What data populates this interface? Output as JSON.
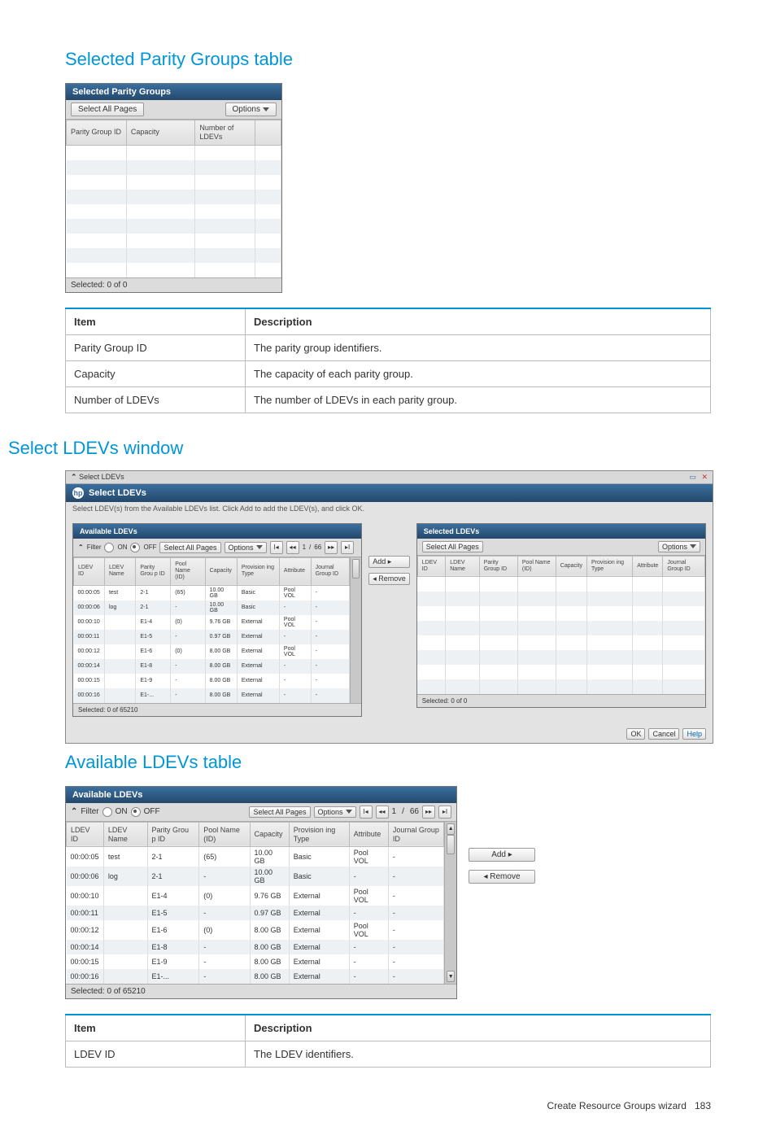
{
  "section1": {
    "heading": "Selected Parity Groups table",
    "panel_title": "Selected Parity Groups",
    "select_all": "Select All Pages",
    "options": "Options",
    "columns": [
      "Parity\nGroup ID",
      "Capacity",
      "Number\nof LDEVs",
      ""
    ],
    "selected_text": "Selected: 0   of  0",
    "def_table": {
      "head": [
        "Item",
        "Description"
      ],
      "rows": [
        [
          "Parity Group ID",
          "The parity group identifiers."
        ],
        [
          "Capacity",
          "The capacity of each parity group."
        ],
        [
          "Number of LDEVs",
          "The number of LDEVs in each parity group."
        ]
      ]
    }
  },
  "section2": {
    "heading": "Select LDEVs window",
    "dlg_title_bar": "Select LDEVs",
    "dlg_title": "Select LDEVs",
    "dlg_instr": "Select LDEV(s) from the Available LDEVs list. Click Add to add the LDEV(s), and click OK.",
    "available": {
      "title": "Available LDEVs",
      "filter": "Filter",
      "on": "ON",
      "off": "OFF",
      "select_all": "Select All Pages",
      "options": "Options",
      "page_current": "1",
      "page_sep": "/",
      "page_total": "66",
      "columns": [
        "LDEV ID",
        "LDEV\nName",
        "Parity\nGrou\np ID",
        "Pool\nName\n(ID)",
        "Capacity",
        "Provision\ning Type",
        "Attribute",
        "Journal\nGroup ID"
      ],
      "rows": [
        [
          "00:00:05",
          "test",
          "2-1",
          "(65)",
          "10.00 GB",
          "Basic",
          "Pool VOL",
          "-"
        ],
        [
          "00:00:06",
          "log",
          "2-1",
          "-",
          "10.00 GB",
          "Basic",
          "-",
          "-"
        ],
        [
          "00:00:10",
          "",
          "E1-4",
          "(0)",
          "9.76 GB",
          "External",
          "Pool VOL",
          "-"
        ],
        [
          "00:00:11",
          "",
          "E1-5",
          "-",
          "0.97 GB",
          "External",
          "-",
          "-"
        ],
        [
          "00:00:12",
          "",
          "E1-6",
          "(0)",
          "8.00 GB",
          "External",
          "Pool VOL",
          "-"
        ],
        [
          "00:00:14",
          "",
          "E1-8",
          "-",
          "8.00 GB",
          "External",
          "-",
          "-"
        ],
        [
          "00:00:15",
          "",
          "E1-9",
          "-",
          "8.00 GB",
          "External",
          "-",
          "-"
        ],
        [
          "00:00:16",
          "",
          "E1-...",
          "-",
          "8.00 GB",
          "External",
          "-",
          "-"
        ]
      ],
      "selected_text": "Selected: 0   of  65210"
    },
    "add_btn": "Add ▸",
    "remove_btn": "◂ Remove",
    "selected": {
      "title": "Selected LDEVs",
      "select_all": "Select All Pages",
      "options": "Options",
      "columns": [
        "LDEV ID",
        "LDEV\nName",
        "Parity\nGroup\nID",
        "Pool\nName\n(ID)",
        "Capacity",
        "Provision\ning Type",
        "Attribute",
        "Journal\nGroup\nID"
      ],
      "selected_text": "Selected: 0   of  0"
    },
    "ok": "OK",
    "cancel": "Cancel",
    "help": "Help"
  },
  "section3": {
    "heading": "Available LDEVs table",
    "panel": {
      "title": "Available LDEVs",
      "filter": "Filter",
      "on": "ON",
      "off": "OFF",
      "select_all": "Select All Pages",
      "options": "Options",
      "page_current": "1",
      "page_sep": "/",
      "page_total": "66",
      "columns": [
        "LDEV ID",
        "LDEV\nName",
        "Parity\nGrou\np ID",
        "Pool\nName\n(ID)",
        "Capacity",
        "Provision\ning Type",
        "Attribute",
        "Journal\nGroup ID"
      ],
      "rows": [
        [
          "00:00:05",
          "test",
          "2-1",
          "(65)",
          "10.00 GB",
          "Basic",
          "Pool VOL",
          "-"
        ],
        [
          "00:00:06",
          "log",
          "2-1",
          "-",
          "10.00 GB",
          "Basic",
          "-",
          "-"
        ],
        [
          "00:00:10",
          "",
          "E1-4",
          "(0)",
          "9.76 GB",
          "External",
          "Pool VOL",
          "-"
        ],
        [
          "00:00:11",
          "",
          "E1-5",
          "-",
          "0.97 GB",
          "External",
          "-",
          "-"
        ],
        [
          "00:00:12",
          "",
          "E1-6",
          "(0)",
          "8.00 GB",
          "External",
          "Pool VOL",
          "-"
        ],
        [
          "00:00:14",
          "",
          "E1-8",
          "-",
          "8.00 GB",
          "External",
          "-",
          "-"
        ],
        [
          "00:00:15",
          "",
          "E1-9",
          "-",
          "8.00 GB",
          "External",
          "-",
          "-"
        ],
        [
          "00:00:16",
          "",
          "E1-...",
          "-",
          "8.00 GB",
          "External",
          "-",
          "-"
        ]
      ],
      "selected_text": "Selected: 0   of  65210"
    },
    "add_btn": "Add ▸",
    "remove_btn": "◂ Remove",
    "def_table": {
      "head": [
        "Item",
        "Description"
      ],
      "rows": [
        [
          "LDEV ID",
          "The LDEV identifiers."
        ]
      ]
    }
  },
  "footer": {
    "text": "Create Resource Groups wizard",
    "page": "183"
  },
  "icons": {
    "first": "I◂",
    "prev": "◂◂",
    "next": "▸▸",
    "last": "▸I",
    "max": "▭",
    "close": "✕",
    "collapse": "⌃"
  }
}
